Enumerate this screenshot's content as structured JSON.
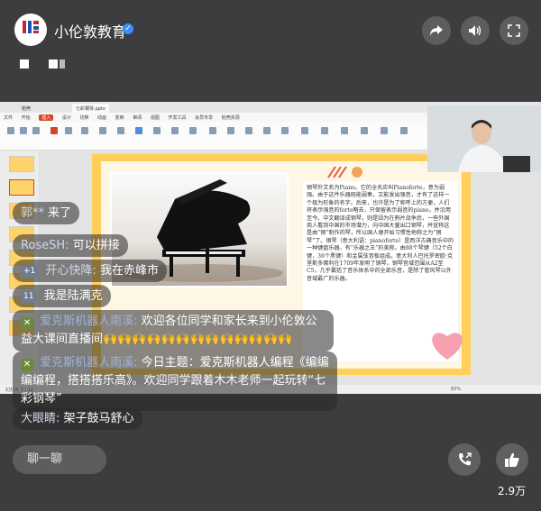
{
  "header": {
    "brand_name": "小伦敦教育",
    "logo_text": "小伦敦教育",
    "verified_mark": "✓",
    "icons": [
      "share-icon",
      "volume-icon",
      "fullscreen-icon"
    ]
  },
  "screen": {
    "tabs": [
      "稻壳",
      "七彩钢琴.pptx"
    ],
    "ribbon": [
      "文件",
      "开始",
      "插入",
      "设计",
      "切换",
      "动画",
      "放映",
      "审阅",
      "视图",
      "开发工具",
      "会员专享",
      "稻壳资源"
    ],
    "ribbon_active": "插入",
    "slide_text": "钢琴外文名为Piano。它的全名应叫Pianoforte，意为弱强。由于这件乐器既能弱奏，又能发出强音，才有了这样一个极为形象的名字。后来，也许是为了称呼上的方便，人们将表示强音的forte略去，只保留表示弱音的piano，并沿用至今。中文翻译成钢琴，则是因为在鸦片战争后，一些外国商人看到中国的市场潜力，向中国大量出口钢琴，并宣称这是由“钢”制作的琴，所以国人便开始习惯性地称之为“钢琴”了。钢琴（意大利语：pianoforte）是西洋古典音乐中的一种键盘乐器，有“乐器之王”的美称。由88个琴键（52个白键，36个黑键）和金属弦音板组成。意大利人巴托罗密欧·克里斯多佛利在1709年发明了钢琴。钢琴音域范围从A2至C5，几乎囊括了音乐体系中的全部乐音，是除了管风琴以外音域最广的乐器。",
    "status_left": "幻灯片 1 / 12",
    "zoom": "83%"
  },
  "chat": [
    {
      "nick": "郭**",
      "text": "来了"
    },
    {
      "nick": "RoseSH:",
      "text": "可以拼接"
    },
    {
      "level": "+1",
      "nick": "开心快降:",
      "text": "我在赤峰市"
    },
    {
      "level": "11",
      "nick": "",
      "text": "我是陆满克"
    },
    {
      "nick": "爱克斯机器人南溪:",
      "text": "欢迎各位同学和家长来到小伦敦公益大课间直播间🙌🙌🙌🙌🙌🙌🙌🙌🙌🙌🙌🙌🙌"
    },
    {
      "nick": "爱克斯机器人南溪:",
      "text": "今日主题：爱克斯机器人编程《编编编编程，搭搭搭乐高》。欢迎同学跟着木木老师一起玩转“七彩钢琴”"
    },
    {
      "nick": "大眼睛:",
      "text": "架子鼓马舒心"
    }
  ],
  "footer": {
    "comment_placeholder": "聊一聊",
    "like_count": "2.9万"
  },
  "colors": {
    "accent": "#ffcf5a",
    "background": "#3d3c3f",
    "ppt_red": "#d24726"
  }
}
